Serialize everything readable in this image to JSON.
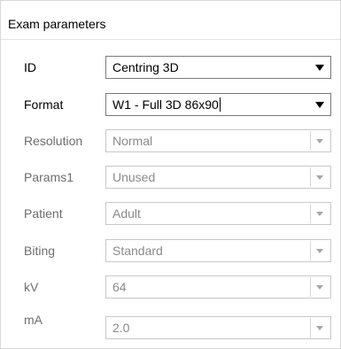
{
  "group": {
    "title": "Exam parameters"
  },
  "fields": [
    {
      "label": "ID",
      "value": "Centring 3D",
      "enabled": true
    },
    {
      "label": "Format",
      "value": "W1 - Full 3D 86x90",
      "enabled": true
    },
    {
      "label": "Resolution",
      "value": "Normal",
      "enabled": false
    },
    {
      "label": "Params1",
      "value": "Unused",
      "enabled": false
    },
    {
      "label": "Patient",
      "value": "Adult",
      "enabled": false
    },
    {
      "label": "Biting",
      "value": "Standard",
      "enabled": false
    },
    {
      "label": "kV",
      "value": "64",
      "enabled": false
    },
    {
      "label": "mA",
      "value": "2.0",
      "enabled": false
    }
  ],
  "icons": {
    "dropdown": "chevron-down-icon"
  },
  "colors": {
    "disabled_text": "#6d6d6d",
    "disabled_border": "#c8c8c8"
  }
}
